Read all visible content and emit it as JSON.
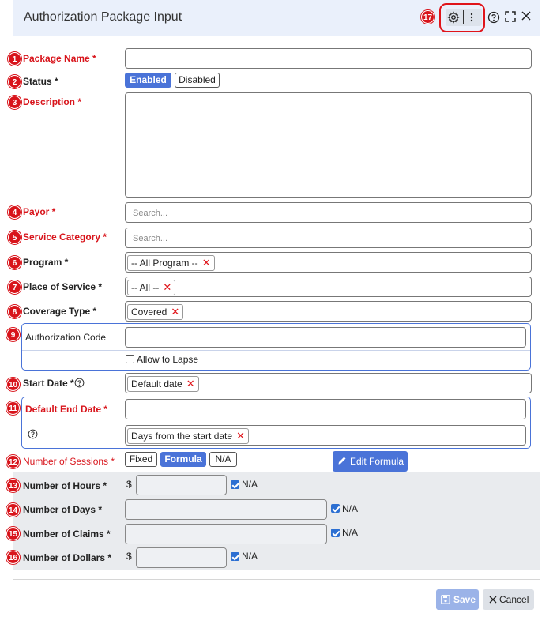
{
  "header": {
    "title": "Authorization Package Input",
    "badge": "17",
    "icons": [
      "gear-icon",
      "kebab-menu-icon",
      "help-icon",
      "expand-icon",
      "close-icon"
    ]
  },
  "fields": {
    "package_name": {
      "badge": "1",
      "label": "Package Name *",
      "value": ""
    },
    "status": {
      "badge": "2",
      "label": "Status *",
      "options": [
        "Enabled",
        "Disabled"
      ],
      "selected": "Enabled"
    },
    "description": {
      "badge": "3",
      "label": "Description *",
      "value": ""
    },
    "payor": {
      "badge": "4",
      "label": "Payor *",
      "placeholder": "Search..."
    },
    "service_category": {
      "badge": "5",
      "label": "Service Category *",
      "placeholder": "Search..."
    },
    "program": {
      "badge": "6",
      "label": "Program *",
      "tag": "-- All Program --"
    },
    "place_of_service": {
      "badge": "7",
      "label": "Place of Service *",
      "tag": "-- All --"
    },
    "coverage_type": {
      "badge": "8",
      "label": "Coverage Type *",
      "tag": "Covered"
    },
    "authorization_code": {
      "badge": "9",
      "label": "Authorization Code",
      "value": "",
      "allow_lapse_label": "Allow to Lapse",
      "allow_lapse_checked": false
    },
    "start_date": {
      "badge": "10",
      "label": "Start Date *",
      "tag": "Default date"
    },
    "default_end_date": {
      "badge": "11",
      "label": "Default End Date *",
      "value": "",
      "tag": "Days from the start date"
    },
    "number_of_sessions": {
      "badge": "12",
      "label": "Number of Sessions *",
      "options": [
        "Fixed",
        "Formula",
        "N/A"
      ],
      "selected": "Formula",
      "edit_formula_label": "Edit Formula"
    },
    "number_of_hours": {
      "badge": "13",
      "label": "Number of Hours *",
      "prefix": "$",
      "na_label": "N/A",
      "na_checked": true
    },
    "number_of_days": {
      "badge": "14",
      "label": "Number of Days *",
      "na_label": "N/A",
      "na_checked": true
    },
    "number_of_claims": {
      "badge": "15",
      "label": "Number of Claims *",
      "na_label": "N/A",
      "na_checked": true
    },
    "number_of_dollars": {
      "badge": "16",
      "label": "Number of Dollars *",
      "prefix": "$",
      "na_label": "N/A",
      "na_checked": true
    }
  },
  "footer": {
    "save_label": "Save",
    "cancel_label": "Cancel"
  },
  "colors": {
    "accent": "#4a73d8",
    "required": "#d8141b",
    "header_bg": "#eaf0fb",
    "badge": "#d8141b"
  }
}
